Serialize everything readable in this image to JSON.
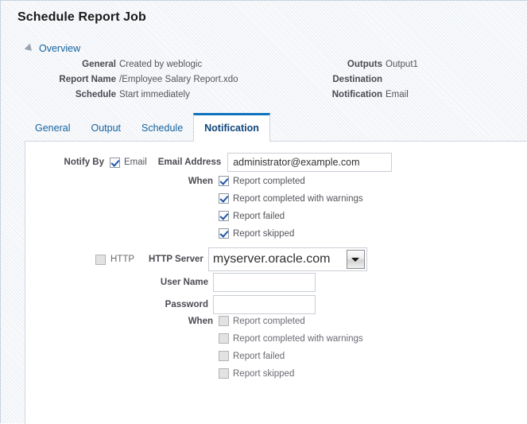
{
  "page": {
    "title": "Schedule Report Job"
  },
  "overview": {
    "section_label": "Overview",
    "disclosure_icon": "triangle-expanded-icon",
    "left_rows": [
      {
        "label": "General",
        "value": "Created by weblogic"
      },
      {
        "label": "Report Name",
        "value": "/Employee Salary Report.xdo"
      },
      {
        "label": "Schedule",
        "value": "Start immediately"
      }
    ],
    "right_rows": [
      {
        "label": "Outputs",
        "value": "Output1"
      },
      {
        "label": "Destination",
        "value": ""
      },
      {
        "label": "Notification",
        "value": "Email"
      }
    ]
  },
  "tabs": [
    {
      "label": "General",
      "active": false
    },
    {
      "label": "Output",
      "active": false
    },
    {
      "label": "Schedule",
      "active": false
    },
    {
      "label": "Notification",
      "active": true
    }
  ],
  "notification": {
    "notify_by_label": "Notify By",
    "email": {
      "checkbox_checked": true,
      "checkbox_label": "Email",
      "address_label": "Email Address",
      "address_value": "administrator@example.com",
      "address_placeholder": "",
      "when_label": "When",
      "conditions": [
        {
          "label": "Report completed",
          "checked": true
        },
        {
          "label": "Report completed with warnings",
          "checked": true
        },
        {
          "label": "Report failed",
          "checked": true
        },
        {
          "label": "Report skipped",
          "checked": true
        }
      ]
    },
    "http": {
      "checkbox_checked": false,
      "checkbox_label": "HTTP",
      "server_label": "HTTP Server",
      "server_value": "myserver.oracle.com",
      "server_dropdown_icon": "chevron-down-icon",
      "username_label": "User Name",
      "username_value": "",
      "password_label": "Password",
      "password_value": "",
      "when_label": "When",
      "conditions": [
        {
          "label": "Report completed",
          "checked": false
        },
        {
          "label": "Report completed with warnings",
          "checked": false
        },
        {
          "label": "Report failed",
          "checked": false
        },
        {
          "label": "Report skipped",
          "checked": false
        }
      ]
    }
  },
  "colors": {
    "accent": "#1073bd",
    "link": "#14639e",
    "check": "#1f56a8",
    "panel_bg": "#ffffff"
  }
}
